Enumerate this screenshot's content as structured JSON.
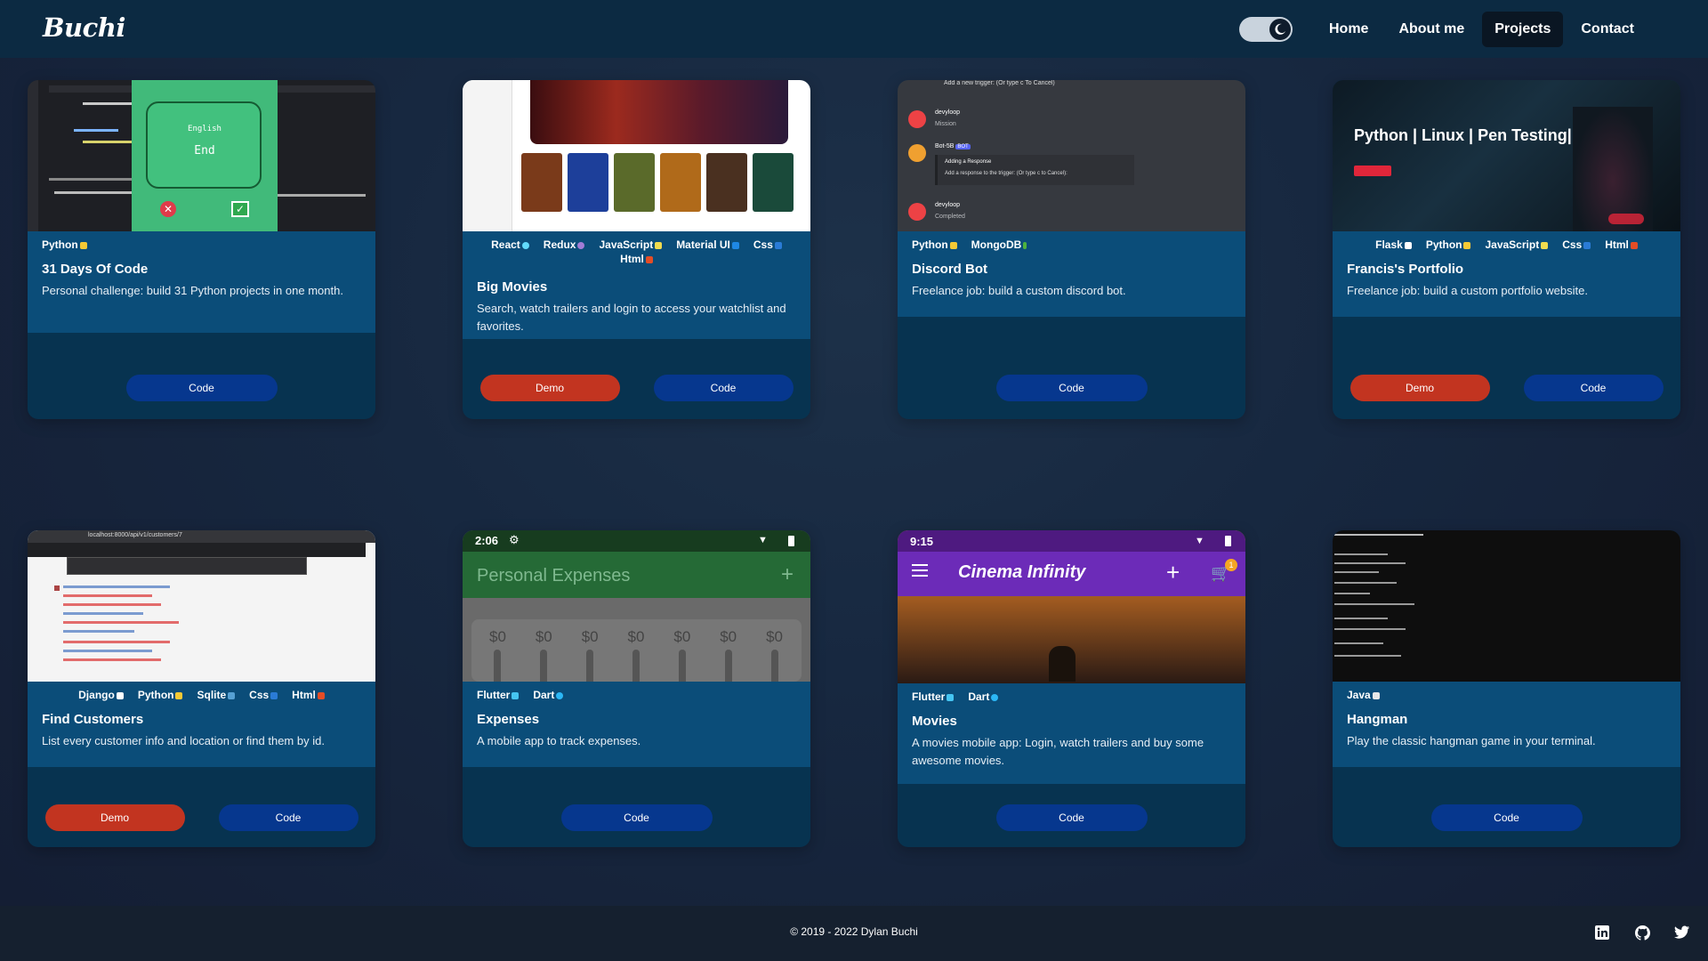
{
  "header": {
    "logo": "Buchi",
    "nav": [
      "Home",
      "About me",
      "Projects",
      "Contact"
    ],
    "active_nav": "Projects",
    "theme_toggle": "dark-mode"
  },
  "cards": [
    {
      "tags": [
        "Python"
      ],
      "title": "31 Days Of Code",
      "description": "Personal challenge: build 31 Python projects in one month.",
      "buttons": [
        "Code"
      ],
      "screenshot": {
        "panel_line1": "English",
        "panel_line2": "End"
      }
    },
    {
      "tags": [
        "React",
        "Redux",
        "JavaScript",
        "Material UI",
        "Css",
        "Html"
      ],
      "title": "Big Movies",
      "description": "Search, watch trailers and login to access your watchlist and favorites.",
      "buttons": [
        "Demo",
        "Code"
      ]
    },
    {
      "tags": [
        "Python",
        "MongoDB"
      ],
      "title": "Discord Bot",
      "description": "Freelance job: build a custom discord bot.",
      "buttons": [
        "Code"
      ],
      "screenshot": {
        "line_add_trigger": "Add a new trigger: (Or type c To Cancel)",
        "user": "devyloop",
        "msg1": "Mission",
        "bot": "Bot-5B",
        "bot_badge": "BOT",
        "adding": "Adding a Response",
        "add_response": "Add a response to the trigger: (Or type c to Cancel):",
        "msg2": "Completed"
      }
    },
    {
      "tags": [
        "Flask",
        "Python",
        "JavaScript",
        "Css",
        "Html"
      ],
      "title": "Francis's Portfolio",
      "description": "Freelance job: build a custom portfolio website.",
      "buttons": [
        "Demo",
        "Code"
      ],
      "screenshot": {
        "headline": "Python | Linux | Pen Testing|"
      }
    },
    {
      "tags": [
        "Django",
        "Python",
        "Sqlite",
        "Css",
        "Html"
      ],
      "title": "Find Customers",
      "description": "List every customer info and location or find them by id.",
      "buttons": [
        "Demo",
        "Code"
      ],
      "screenshot": {
        "url": "localhost:8000/api/v1/customers/7"
      }
    },
    {
      "tags": [
        "Flutter",
        "Dart"
      ],
      "title": "Expenses",
      "description": "A mobile app to track expenses.",
      "buttons": [
        "Code"
      ],
      "screenshot": {
        "time": "2:06",
        "app_title": "Personal Expenses",
        "amounts": [
          "$0",
          "$0",
          "$0",
          "$0",
          "$0",
          "$0",
          "$0"
        ]
      }
    },
    {
      "tags": [
        "Flutter",
        "Dart"
      ],
      "title": "Movies",
      "description": "A movies mobile app: Login, watch trailers and buy some awesome movies.",
      "buttons": [
        "Code"
      ],
      "screenshot": {
        "time": "9:15",
        "app_title": "Cinema Infinity",
        "cart_count": "1"
      }
    },
    {
      "tags": [
        "Java"
      ],
      "title": "Hangman",
      "description": "Play the classic hangman game in your terminal.",
      "buttons": [
        "Code"
      ]
    }
  ],
  "footer": {
    "copyright": "© 2019 - 2022  Dylan Buchi",
    "social": [
      "linkedin-icon",
      "github-icon",
      "twitter-icon"
    ]
  },
  "colors": {
    "header_bg": "#0c2a42",
    "card_info_bg": "#0b4d79",
    "code_button": "#06378e",
    "demo_button": "#c23420",
    "footer_bg": "#15202f"
  }
}
